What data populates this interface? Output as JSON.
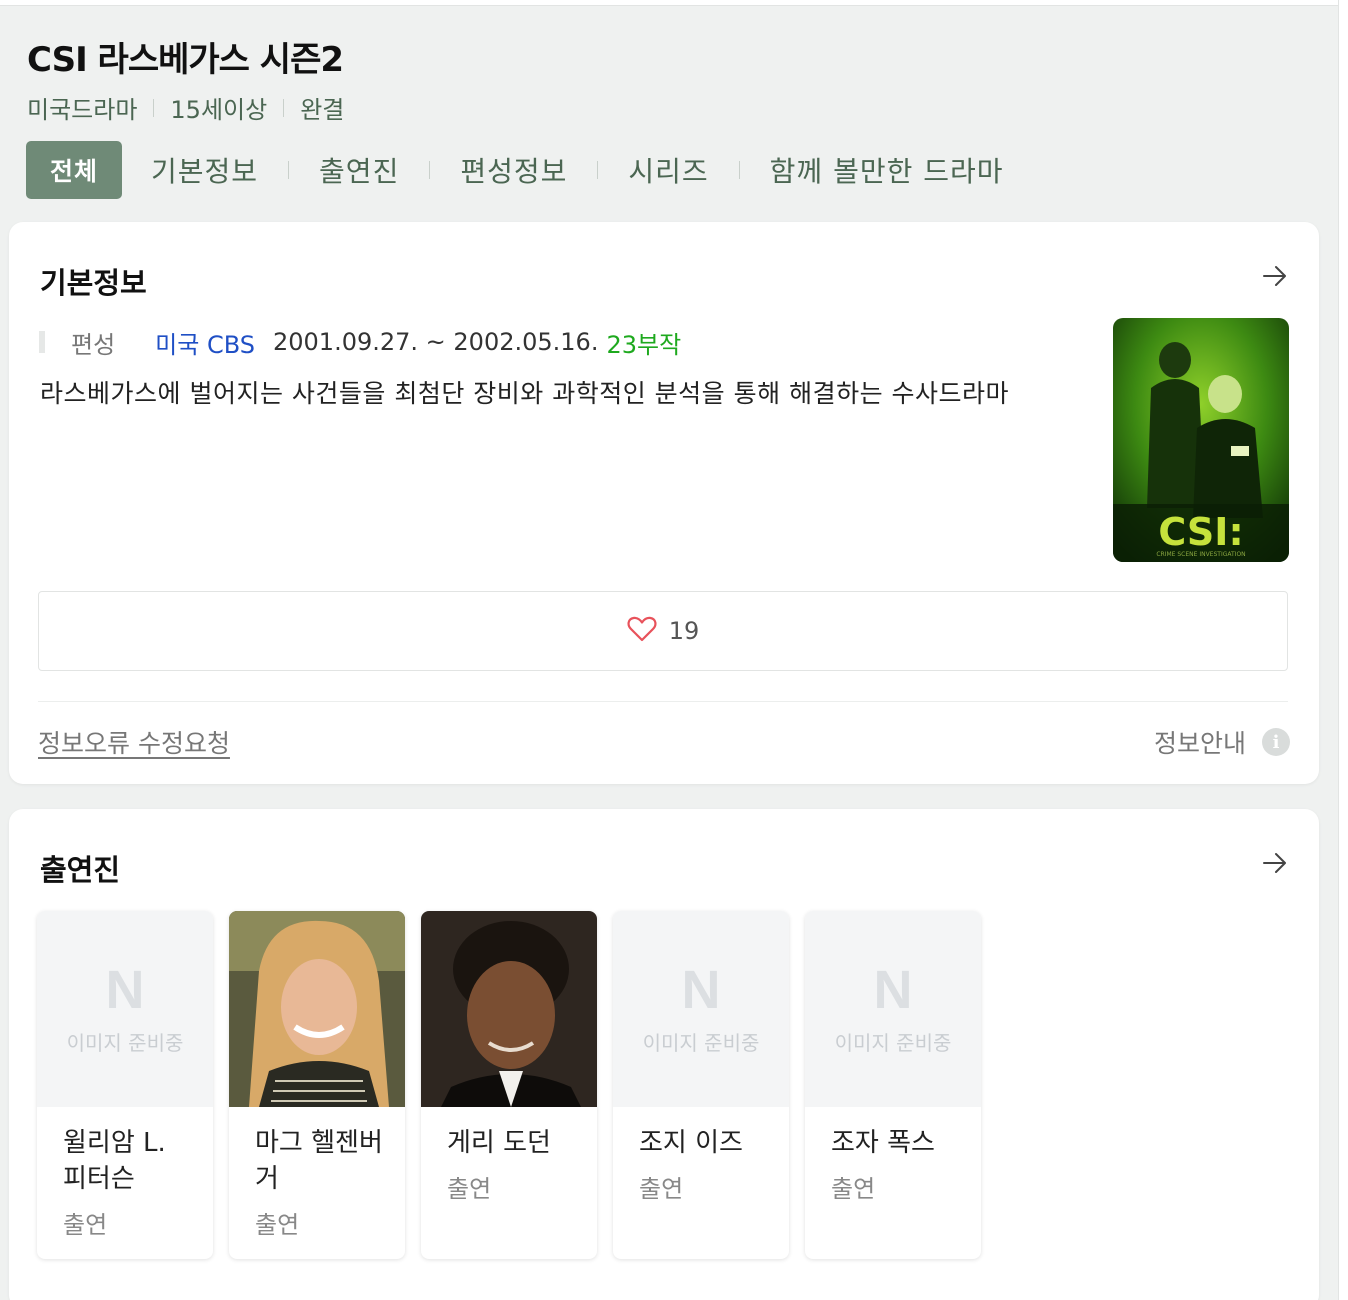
{
  "title": "CSI 라스베가스 시즌2",
  "meta": [
    "미국드라마",
    "15세이상",
    "완결"
  ],
  "tabs": [
    "전체",
    "기본정보",
    "출연진",
    "편성정보",
    "시리즈",
    "함께 볼만한 드라마"
  ],
  "basic_info": {
    "heading": "기본정보",
    "label": "편성",
    "network": "미국 CBS",
    "dates": "2001.09.27. ~ 2002.05.16.",
    "episodes": "23부작",
    "description": "라스베가스에 벌어지는 사건들을 최첨단 장비와 과학적인 분석을 통해 해결하는 수사드라마",
    "poster_text": "CSI:",
    "poster_subtext": "CRIME SCENE INVESTIGATION",
    "likes": "19",
    "error_report": "정보오류 수정요청",
    "info_guide": "정보안내",
    "info_icon": "i"
  },
  "cast_section": {
    "heading": "출연진",
    "placeholder_logo": "N",
    "placeholder_text": "이미지 준비중",
    "members": [
      {
        "name": "윌리암 L. 피터슨",
        "role": "출연",
        "has_photo": false
      },
      {
        "name": "마그 헬젠버거",
        "role": "출연",
        "has_photo": true
      },
      {
        "name": "게리 도던",
        "role": "출연",
        "has_photo": true
      },
      {
        "name": "조지 이즈",
        "role": "출연",
        "has_photo": false
      },
      {
        "name": "조자 폭스",
        "role": "출연",
        "has_photo": false
      }
    ]
  },
  "colors": {
    "accent": "#6f8a77",
    "meta_text": "#4b6652",
    "network_link": "#1f4fc5",
    "episodes": "#1ea91e",
    "heart": "#e8525b"
  }
}
